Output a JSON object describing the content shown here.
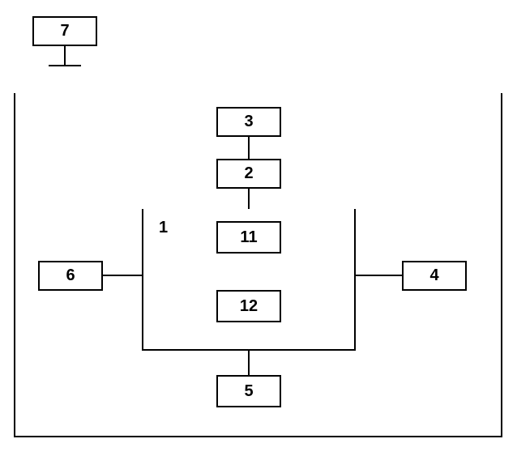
{
  "nodes": {
    "n1_label": "1",
    "n2": "2",
    "n3": "3",
    "n4": "4",
    "n5": "5",
    "n6": "6",
    "n7": "7",
    "n11": "11",
    "n12": "12"
  }
}
